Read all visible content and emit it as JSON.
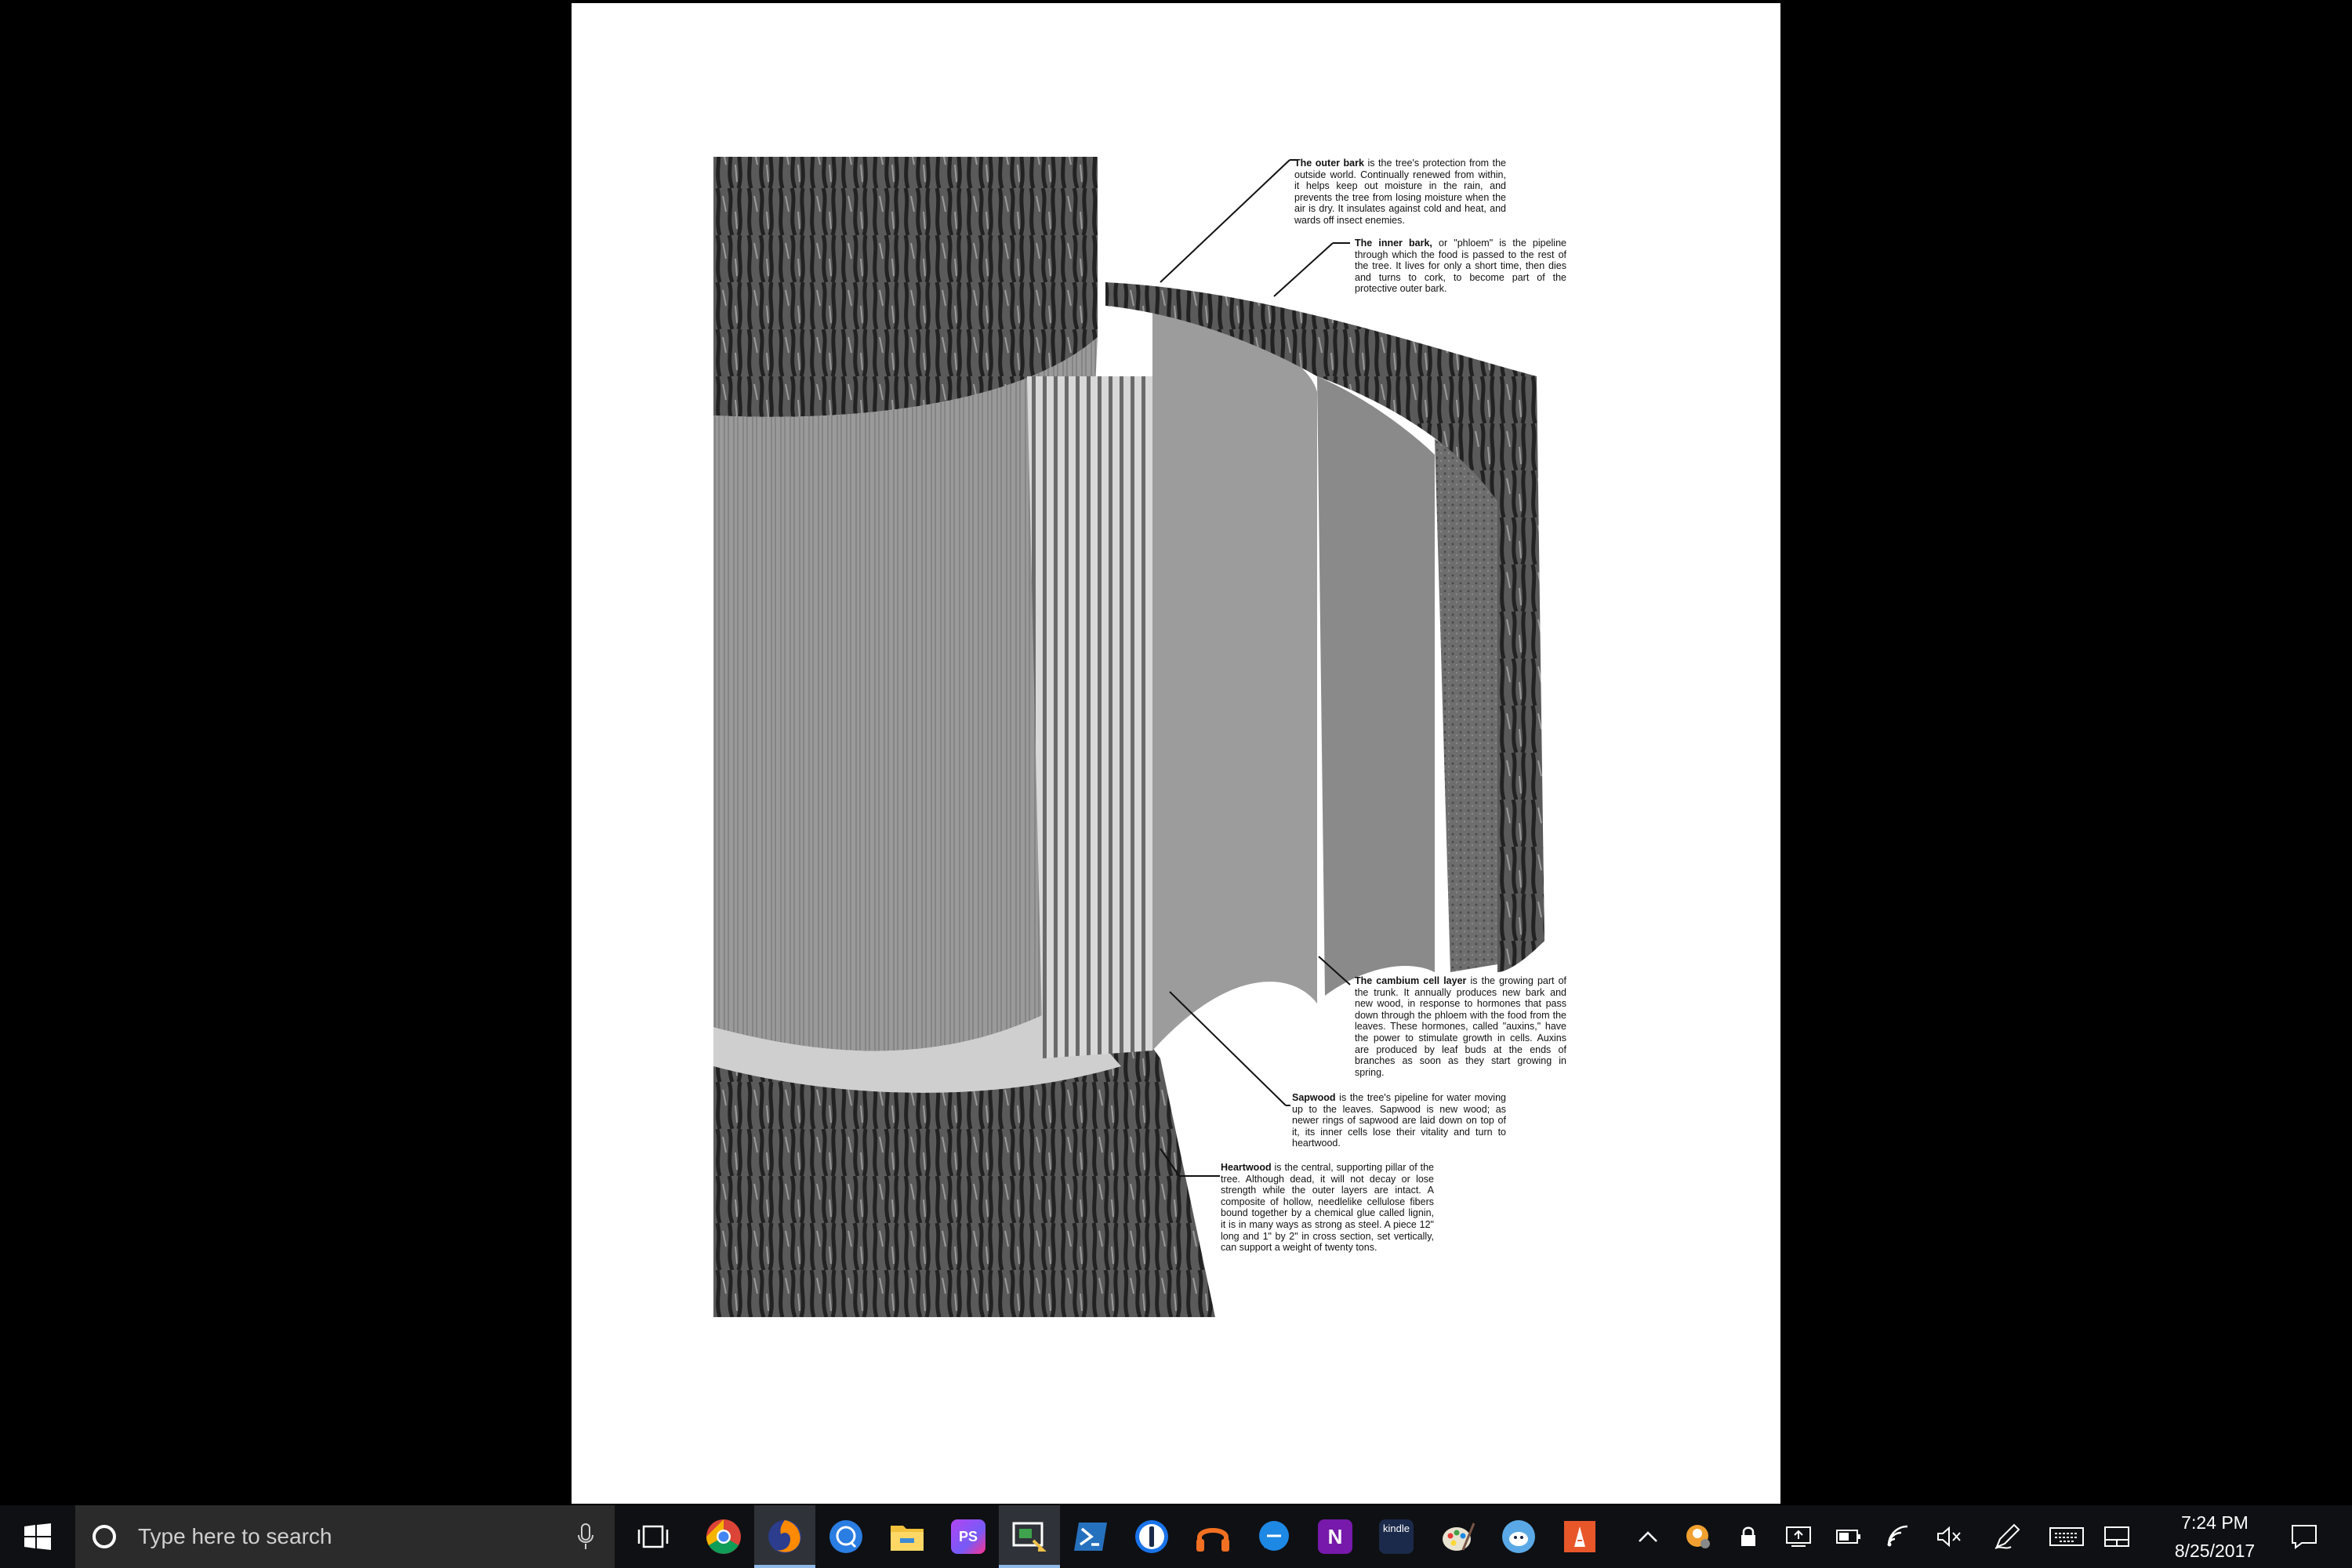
{
  "document": {
    "captions": {
      "outer_bark": {
        "term": "The outer bark",
        "text": " is the tree's protection from the outside world. Continually renewed from within, it helps keep out moisture in the rain, and prevents the tree from losing moisture when the air is dry. It insulates against cold and heat, and wards off insect enemies."
      },
      "inner_bark": {
        "term": "The inner bark,",
        "text": " or \"phloem\" is the pipeline through which the food is passed to the rest of the tree. It lives for only a short time, then dies and turns to cork, to become part of the protective outer bark."
      },
      "cambium": {
        "term": "The cambium cell layer",
        "text": " is the growing part of the trunk. It annually produces new bark and new wood, in response to hormones that pass down through the phloem with the food from the leaves. These hormones, called \"auxins,\" have the power to stimulate growth in cells. Auxins are produced by leaf buds at the ends of branches as soon as they start growing in spring."
      },
      "sapwood": {
        "term": "Sapwood",
        "text": " is the tree's pipeline for water moving up to the leaves. Sapwood is new wood; as newer rings of sapwood are laid down on top of it, its inner cells lose their vitality and turn to heartwood."
      },
      "heartwood": {
        "term": "Heartwood",
        "text": " is the central, supporting pillar of the tree. Although dead, it will not decay or lose strength while the outer layers are intact. A composite of hollow, needlelike cellulose fibers bound together by a chemical glue called lignin, it is in many ways as strong as steel. A piece 12\" long and 1\" by 2\" in cross section, set vertically, can support a weight of twenty tons."
      }
    }
  },
  "taskbar": {
    "search": {
      "placeholder": "Type here to search"
    },
    "apps": [
      {
        "name": "chrome-icon",
        "label": "Chrome"
      },
      {
        "name": "firefox-icon",
        "label": "Firefox"
      },
      {
        "name": "chat-app-icon",
        "label": "Chat"
      },
      {
        "name": "file-explorer-icon",
        "label": "File Explorer"
      },
      {
        "name": "phpstorm-icon",
        "label": "PS"
      },
      {
        "name": "remote-desktop-icon",
        "label": "Remote"
      },
      {
        "name": "powershell-icon",
        "label": "PowerShell"
      },
      {
        "name": "password-manager-icon",
        "label": "1Password"
      },
      {
        "name": "headset-app-icon",
        "label": "Headset"
      },
      {
        "name": "messaging-icon",
        "label": "Messaging"
      },
      {
        "name": "onenote-icon",
        "label": "N"
      },
      {
        "name": "kindle-icon",
        "label": "kindle"
      },
      {
        "name": "paint-icon",
        "label": "Paint"
      },
      {
        "name": "bird-app-icon",
        "label": "Bird"
      },
      {
        "name": "document-app-icon",
        "label": "Doc"
      }
    ],
    "clock": {
      "time": "7:24 PM",
      "date": "8/25/2017"
    }
  }
}
